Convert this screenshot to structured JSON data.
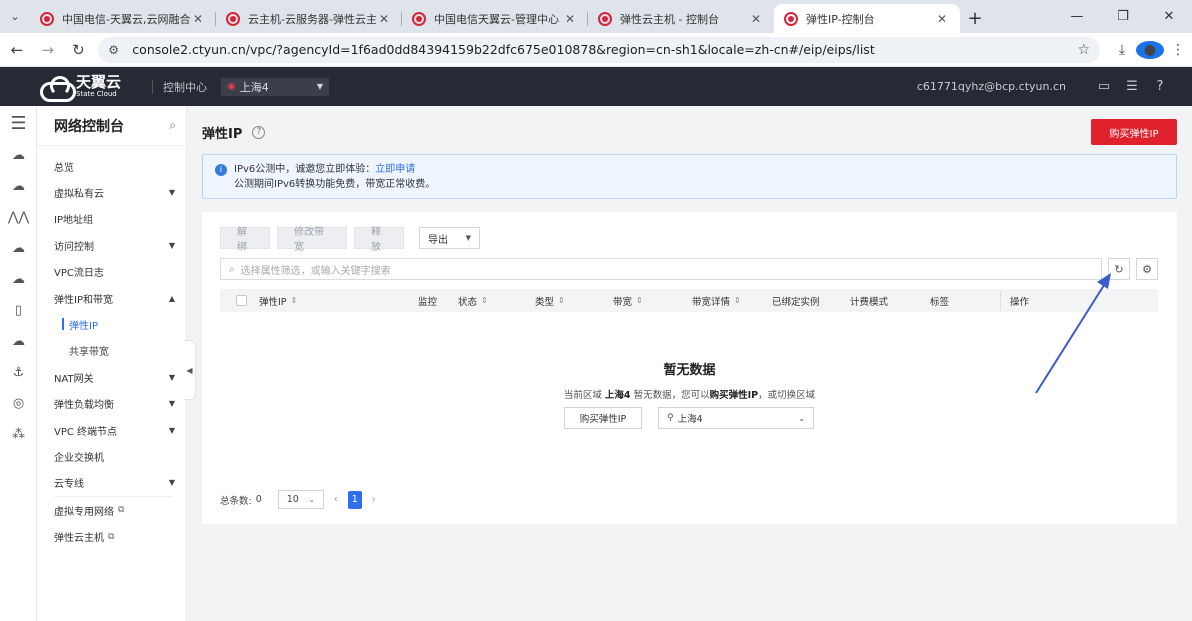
{
  "browser": {
    "tabs": [
      {
        "title": "中国电信-天翼云,云网融合,安全",
        "active": false
      },
      {
        "title": "云主机-云服务器-弹性云主机-天",
        "active": false
      },
      {
        "title": "中国电信天翼云-管理中心",
        "active": false
      },
      {
        "title": "弹性云主机 - 控制台",
        "active": false
      },
      {
        "title": "弹性IP-控制台",
        "active": true
      }
    ],
    "url": "console2.ctyun.cn/vpc/?agencyId=1f6ad0dd84394159b22dfc675e010878&region=cn-sh1&locale=zh-cn#/eip/eips/list"
  },
  "header": {
    "logo_cn": "天翼云",
    "logo_en": "State Cloud",
    "control_center": "控制中心",
    "region": "上海4",
    "user": "c61771qyhz@bcp.ctyun.cn"
  },
  "sidebar": {
    "title": "网络控制台",
    "items": [
      {
        "label": "总览"
      },
      {
        "label": "虚拟私有云",
        "arrow": "▼"
      },
      {
        "label": "IP地址组"
      },
      {
        "label": "访问控制",
        "arrow": "▼"
      },
      {
        "label": "VPC流日志"
      },
      {
        "label": "弹性IP和带宽",
        "arrow": "▲"
      },
      {
        "label": "弹性IP"
      },
      {
        "label": "共享带宽"
      },
      {
        "label": "NAT网关",
        "arrow": "▼"
      },
      {
        "label": "弹性负载均衡",
        "arrow": "▼"
      },
      {
        "label": "VPC 终端节点",
        "arrow": "▼"
      },
      {
        "label": "企业交换机"
      },
      {
        "label": "云专线",
        "arrow": "▼"
      },
      {
        "label": "虚拟专用网络"
      },
      {
        "label": "弹性云主机"
      }
    ]
  },
  "page": {
    "title": "弹性IP",
    "buy_button": "购买弹性IP",
    "notice": {
      "line1_prefix": "IPv6公测中，诚邀您立即体验：",
      "line1_link": "立即申请",
      "line2": "公测期间IPv6转换功能免费，带宽正常收费。"
    },
    "toolbar": {
      "unbind": "解绑",
      "modify_bw": "修改带宽",
      "release": "释放",
      "export": "导出"
    },
    "search_placeholder": "选择属性筛选，或输入关键字搜索",
    "columns": [
      "弹性IP",
      "监控",
      "状态",
      "类型",
      "带宽",
      "带宽详情",
      "已绑定实例",
      "计费模式",
      "标签",
      "操作"
    ],
    "empty": {
      "title": "暂无数据",
      "desc_prefix": "当前区域",
      "desc_region": "上海4",
      "desc_mid": "暂无数据，您可以",
      "desc_action": "购买弹性IP",
      "desc_suffix": "，或切换区域",
      "buy_button": "购买弹性IP",
      "region_select": "上海4"
    },
    "pager": {
      "total_label": "总条数:",
      "total": "0",
      "page_size": "10",
      "current_page": "1"
    }
  },
  "colors": {
    "accent_red": "#e0222e",
    "link_blue": "#2f6fed",
    "header_bg": "#262a34"
  }
}
